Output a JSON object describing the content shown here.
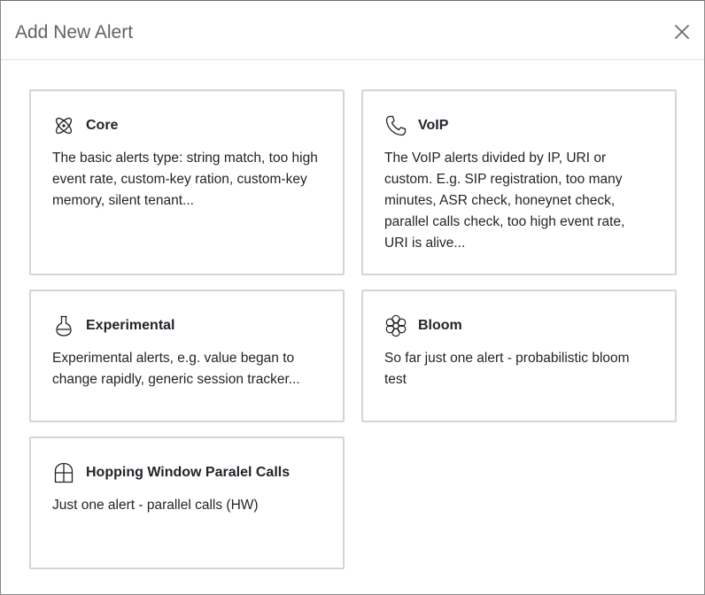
{
  "modal": {
    "title": "Add New Alert",
    "close_icon": "close-icon"
  },
  "cards": [
    {
      "icon": "atom-icon",
      "title": "Core",
      "description": "The basic alerts type: string match, too high event rate, custom-key ration, custom-key memory, silent tenant..."
    },
    {
      "icon": "phone-icon",
      "title": "VoIP",
      "description": "The VoIP alerts divided by IP, URI or custom. E.g. SIP registration, too many minutes, ASR check, honeynet check, parallel calls check, too high event rate, URI is alive..."
    },
    {
      "icon": "flask-icon",
      "title": "Experimental",
      "description": "Experimental alerts, e.g. value began to change rapidly, generic session tracker..."
    },
    {
      "icon": "flower-icon",
      "title": "Bloom",
      "description": "So far just one alert - probabilistic bloom test"
    },
    {
      "icon": "window-icon",
      "title": "Hopping Window Paralel Calls",
      "description": "Just one alert - parallel calls (HW)"
    }
  ],
  "colors": {
    "title": "#5f6368",
    "card_border": "#d5d5d5",
    "text": "#212529"
  }
}
